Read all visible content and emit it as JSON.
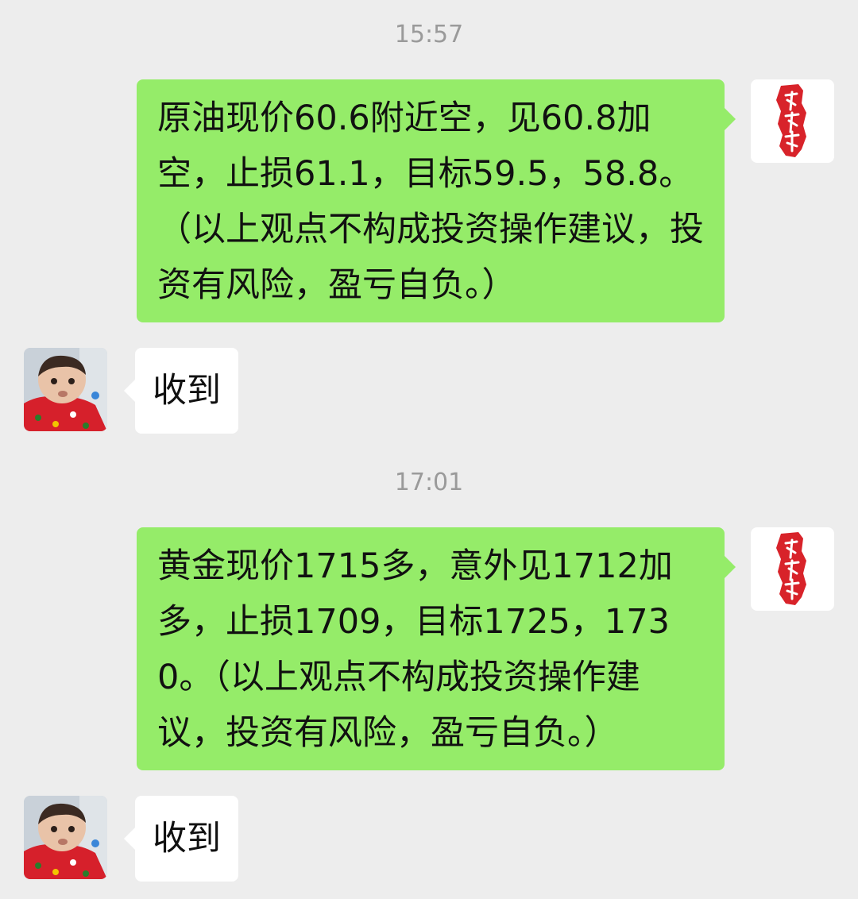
{
  "conversation": {
    "timestamps": [
      "15:57",
      "17:01"
    ],
    "messages": [
      {
        "direction": "outgoing",
        "text": "原油现价60.6附近空，见60.8加空，止损61.1，目标59.5，58.8。（以上观点不构成投资操作建议，投资有风险，盈亏自负。）"
      },
      {
        "direction": "incoming",
        "text": "收到"
      },
      {
        "direction": "outgoing",
        "text": "黄金现价1715多，意外见1712加多，止损1709，目标1725，1730。（以上观点不构成投资操作建议，投资有风险，盈亏自负。）"
      },
      {
        "direction": "incoming",
        "text": "收到"
      }
    ]
  },
  "avatars": {
    "outgoing": "red-seal-logo",
    "incoming": "baby-photo"
  },
  "colors": {
    "background": "#ededed",
    "outgoing_bubble": "#95ec69",
    "incoming_bubble": "#ffffff",
    "timestamp": "#9a9a9a",
    "seal_red": "#d8232a"
  }
}
